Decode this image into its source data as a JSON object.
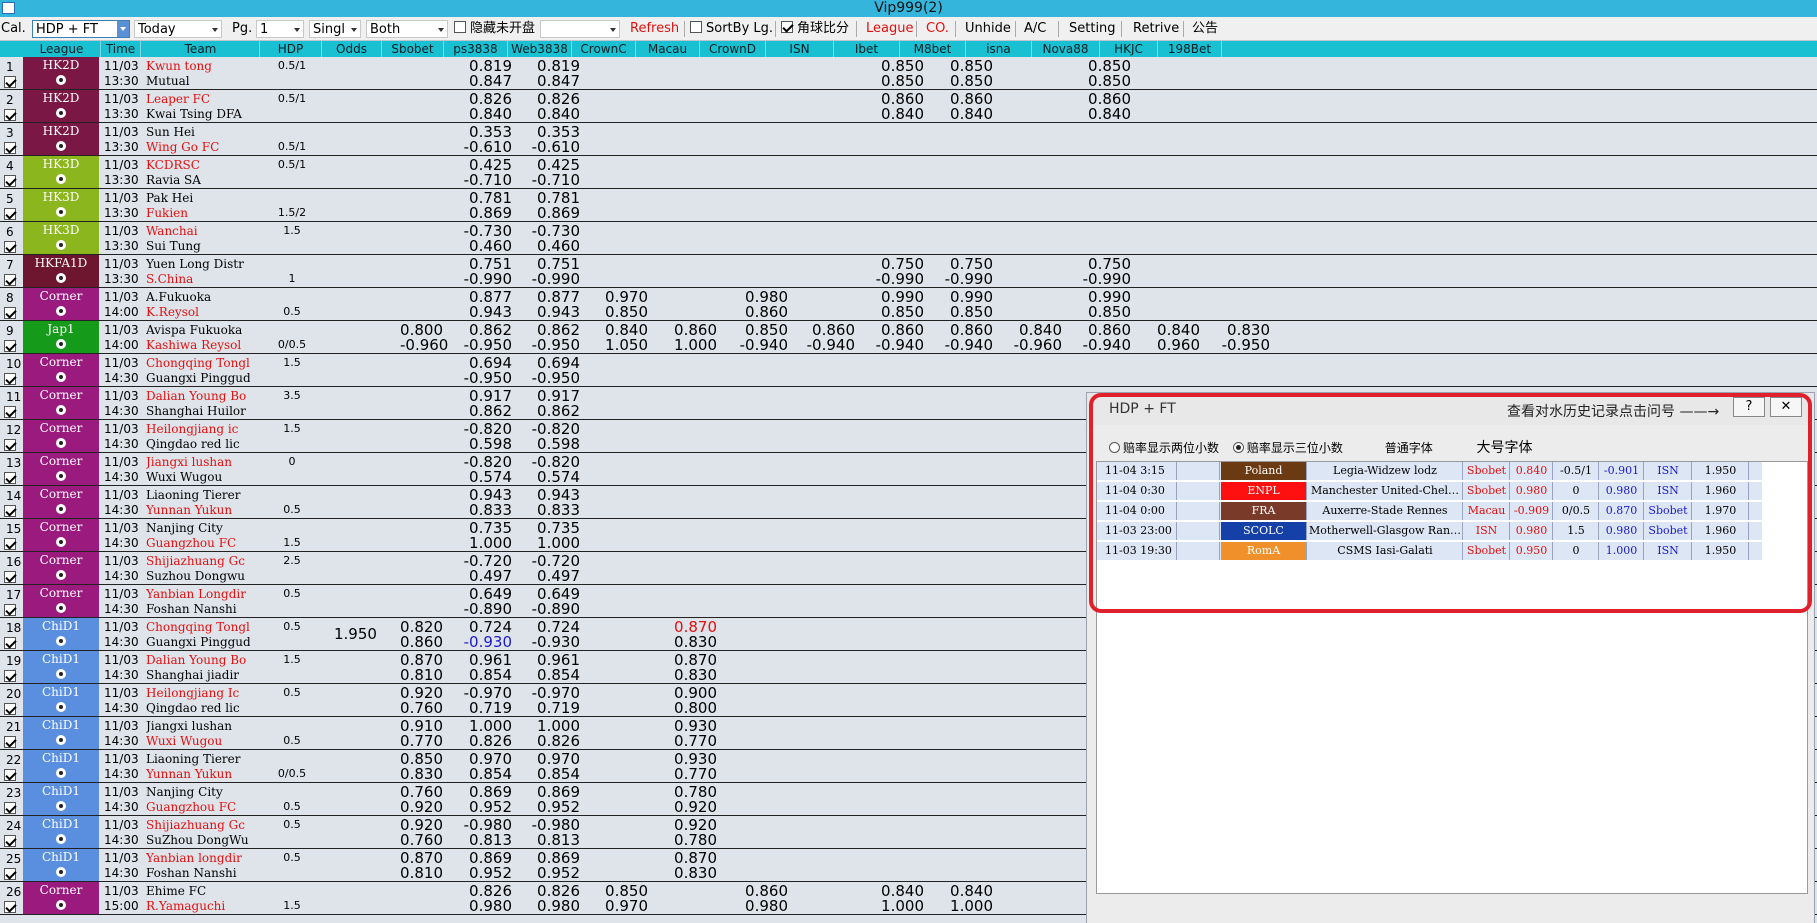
{
  "window": {
    "title": "Vip999(2)"
  },
  "toolbar": {
    "cal_label": "Cal.",
    "market_value": "HDP + FT",
    "date_value": "Today",
    "page_label": "Pg.",
    "page_value": "1",
    "single_value": "Singl",
    "both_value": "Both",
    "hide_unstarted_label": "隐藏未开盘",
    "refresh_label": "Refresh",
    "sortbylg_label": "SortBy Lg.",
    "corner_score_label": "角球比分",
    "league_label": "League",
    "co_label": "CO.",
    "unhide_label": "Unhide",
    "ac_label": "A/C",
    "setting_label": "Setting",
    "retrive_label": "Retrive",
    "notice_label": "公告"
  },
  "columns": [
    "League",
    "Time",
    "Team",
    "HDP",
    "Odds",
    "Sbobet",
    "ps3838",
    "Web3838",
    "CrownC",
    "Macau",
    "CrownD",
    "ISN",
    "Ibet",
    "M8bet",
    "isna",
    "Nova88",
    "HKJC",
    "198Bet"
  ],
  "colors": {
    "HK2D": "#7b1744",
    "HK3D": "#8cb61e",
    "HKFA1D": "#6e1530",
    "Corner": "#9a1a7e",
    "Jap1": "#169a1a",
    "ChiD1": "#5a8fe0"
  },
  "rows": [
    {
      "n": "1",
      "league": "HK2D",
      "c": "HK2D",
      "date": "11/03",
      "time": "13:30",
      "t1": "Kwun tong",
      "t2": "Mutual",
      "t1red": true,
      "t2red": false,
      "h1": "0.5/1",
      "h2": "",
      "ps": [
        "0.819",
        "0.847"
      ],
      "web": [
        "0.819",
        "0.847"
      ],
      "ibet": [
        "0.850",
        "0.850"
      ],
      "m8": [
        "0.850",
        "0.850"
      ],
      "nova": [
        "0.850",
        "0.850"
      ]
    },
    {
      "n": "2",
      "league": "HK2D",
      "c": "HK2D",
      "date": "11/03",
      "time": "13:30",
      "t1": "Leaper FC",
      "t2": "Kwai Tsing DFA",
      "t1red": true,
      "t2red": false,
      "h1": "0.5/1",
      "h2": "",
      "ps": [
        "0.826",
        "0.840"
      ],
      "web": [
        "0.826",
        "0.840"
      ],
      "ibet": [
        "0.860",
        "0.840"
      ],
      "m8": [
        "0.860",
        "0.840"
      ],
      "nova": [
        "0.860",
        "0.840"
      ]
    },
    {
      "n": "3",
      "league": "HK2D",
      "c": "HK2D",
      "date": "11/03",
      "time": "13:30",
      "t1": "Sun Hei",
      "t2": "Wing Go FC",
      "t1red": false,
      "t2red": true,
      "h1": "",
      "h2": "0.5/1",
      "ps": [
        "0.353",
        "-0.610"
      ],
      "web": [
        "0.353",
        "-0.610"
      ]
    },
    {
      "n": "4",
      "league": "HK3D",
      "c": "HK3D",
      "date": "11/03",
      "time": "13:30",
      "t1": "KCDRSC",
      "t2": "Ravia SA",
      "t1red": true,
      "t2red": false,
      "h1": "0.5/1",
      "h2": "",
      "ps": [
        "0.425",
        "-0.710"
      ],
      "web": [
        "0.425",
        "-0.710"
      ]
    },
    {
      "n": "5",
      "league": "HK3D",
      "c": "HK3D",
      "date": "11/03",
      "time": "13:30",
      "t1": "Pak Hei",
      "t2": "Fukien",
      "t1red": false,
      "t2red": true,
      "h1": "",
      "h2": "1.5/2",
      "ps": [
        "0.781",
        "0.869"
      ],
      "web": [
        "0.781",
        "0.869"
      ]
    },
    {
      "n": "6",
      "league": "HK3D",
      "c": "HK3D",
      "date": "11/03",
      "time": "13:30",
      "t1": "Wanchai",
      "t2": "Sui Tung",
      "t1red": true,
      "t2red": false,
      "h1": "1.5",
      "h2": "",
      "ps": [
        "-0.730",
        "0.460"
      ],
      "web": [
        "-0.730",
        "0.460"
      ]
    },
    {
      "n": "7",
      "league": "HKFA1D",
      "c": "HKFA1D",
      "date": "11/03",
      "time": "13:30",
      "t1": "Yuen Long Distr",
      "t2": "S.China",
      "t1red": false,
      "t2red": true,
      "h1": "",
      "h2": "1",
      "ps": [
        "0.751",
        "-0.990"
      ],
      "web": [
        "0.751",
        "-0.990"
      ],
      "ibet": [
        "0.750",
        "-0.990"
      ],
      "m8": [
        "0.750",
        "-0.990"
      ],
      "nova": [
        "0.750",
        "-0.990"
      ]
    },
    {
      "n": "8",
      "league": "Corner",
      "c": "Corner",
      "date": "11/03",
      "time": "14:00",
      "t1": "A.Fukuoka",
      "t2": "K.Reysol",
      "t1red": false,
      "t2red": true,
      "h1": "",
      "h2": "0.5",
      "ps": [
        "0.877",
        "0.943"
      ],
      "web": [
        "0.877",
        "0.943"
      ],
      "crownc": [
        "0.970",
        "0.850"
      ],
      "crownd": [
        "0.980",
        "0.860"
      ],
      "ibet": [
        "0.990",
        "0.850"
      ],
      "m8": [
        "0.990",
        "0.850"
      ],
      "nova": [
        "0.990",
        "0.850"
      ]
    },
    {
      "n": "9",
      "league": "Jap1",
      "c": "Jap1",
      "date": "11/03",
      "time": "14:00",
      "t1": "Avispa Fukuoka",
      "t2": "Kashiwa Reysol",
      "t1red": false,
      "t2red": true,
      "h1": "",
      "h2": "0/0.5",
      "sbo": [
        "0.800",
        "-0.960"
      ],
      "ps": [
        "0.862",
        "-0.950"
      ],
      "web": [
        "0.862",
        "-0.950"
      ],
      "crownc": [
        "0.840",
        "1.050"
      ],
      "macau": [
        "0.860",
        "1.000"
      ],
      "crownd": [
        "0.850",
        "-0.940"
      ],
      "isn": [
        "0.860",
        "-0.940"
      ],
      "ibet": [
        "0.860",
        "-0.940"
      ],
      "m8": [
        "0.860",
        "-0.940"
      ],
      "isna": [
        "0.840",
        "-0.960"
      ],
      "nova": [
        "0.860",
        "-0.940"
      ],
      "hkjc": [
        "0.840",
        "0.960"
      ],
      "b198": [
        "0.830",
        "-0.950"
      ]
    },
    {
      "n": "10",
      "league": "Corner",
      "c": "Corner",
      "date": "11/03",
      "time": "14:30",
      "t1": "Chongqing Tongl",
      "t2": "Guangxi Pinggud",
      "t1red": true,
      "t2red": false,
      "h1": "1.5",
      "h2": "",
      "ps": [
        "0.694",
        "-0.950"
      ],
      "web": [
        "0.694",
        "-0.950"
      ]
    },
    {
      "n": "11",
      "league": "Corner",
      "c": "Corner",
      "date": "11/03",
      "time": "14:30",
      "t1": "Dalian Young Bo",
      "t2": "Shanghai Huilor",
      "t1red": true,
      "t2red": false,
      "h1": "3.5",
      "h2": "",
      "ps": [
        "0.917",
        "0.862"
      ],
      "web": [
        "0.917",
        "0.862"
      ]
    },
    {
      "n": "12",
      "league": "Corner",
      "c": "Corner",
      "date": "11/03",
      "time": "14:30",
      "t1": "Heilongjiang ic",
      "t2": "Qingdao red lic",
      "t1red": true,
      "t2red": false,
      "h1": "1.5",
      "h2": "",
      "ps": [
        "-0.820",
        "0.598"
      ],
      "web": [
        "-0.820",
        "0.598"
      ]
    },
    {
      "n": "13",
      "league": "Corner",
      "c": "Corner",
      "date": "11/03",
      "time": "14:30",
      "t1": "Jiangxi lushan",
      "t2": "Wuxi Wugou",
      "t1red": true,
      "t2red": false,
      "h1": "0",
      "h2": "",
      "ps": [
        "-0.820",
        "0.574"
      ],
      "web": [
        "-0.820",
        "0.574"
      ]
    },
    {
      "n": "14",
      "league": "Corner",
      "c": "Corner",
      "date": "11/03",
      "time": "14:30",
      "t1": "Liaoning Tierer",
      "t2": "Yunnan Yukun",
      "t1red": false,
      "t2red": true,
      "h1": "",
      "h2": "0.5",
      "ps": [
        "0.943",
        "0.833"
      ],
      "web": [
        "0.943",
        "0.833"
      ]
    },
    {
      "n": "15",
      "league": "Corner",
      "c": "Corner",
      "date": "11/03",
      "time": "14:30",
      "t1": "Nanjing City",
      "t2": "Guangzhou FC",
      "t1red": false,
      "t2red": true,
      "h1": "",
      "h2": "1.5",
      "ps": [
        "0.735",
        "1.000"
      ],
      "web": [
        "0.735",
        "1.000"
      ]
    },
    {
      "n": "16",
      "league": "Corner",
      "c": "Corner",
      "date": "11/03",
      "time": "14:30",
      "t1": "Shijiazhuang Gc",
      "t2": "Suzhou Dongwu",
      "t1red": true,
      "t2red": false,
      "h1": "2.5",
      "h2": "",
      "ps": [
        "-0.720",
        "0.497"
      ],
      "web": [
        "-0.720",
        "0.497"
      ]
    },
    {
      "n": "17",
      "league": "Corner",
      "c": "Corner",
      "date": "11/03",
      "time": "14:30",
      "t1": "Yanbian Longdir",
      "t2": "Foshan Nanshi",
      "t1red": true,
      "t2red": false,
      "h1": "0.5",
      "h2": "",
      "ps": [
        "0.649",
        "-0.890"
      ],
      "web": [
        "0.649",
        "-0.890"
      ]
    },
    {
      "n": "18",
      "league": "ChiD1",
      "c": "ChiD1",
      "date": "11/03",
      "time": "14:30",
      "t1": "Chongqing Tongl",
      "t2": "Guangxi Pinggud",
      "t1red": true,
      "t2red": false,
      "h1": "0.5",
      "h2": "",
      "odds": "1.950",
      "sbo": [
        "0.820",
        "0.860"
      ],
      "ps": [
        "0.724",
        "-0.930"
      ],
      "psblue2": true,
      "web": [
        "0.724",
        "-0.930"
      ],
      "macau": [
        "0.870",
        "0.830"
      ],
      "macaured1": true
    },
    {
      "n": "19",
      "league": "ChiD1",
      "c": "ChiD1",
      "date": "11/03",
      "time": "14:30",
      "t1": "Dalian Young Bo",
      "t2": "Shanghai jiadir",
      "t1red": true,
      "t2red": false,
      "h1": "1.5",
      "h2": "",
      "sbo": [
        "0.870",
        "0.810"
      ],
      "ps": [
        "0.961",
        "0.854"
      ],
      "web": [
        "0.961",
        "0.854"
      ],
      "macau": [
        "0.870",
        "0.830"
      ]
    },
    {
      "n": "20",
      "league": "ChiD1",
      "c": "ChiD1",
      "date": "11/03",
      "time": "14:30",
      "t1": "Heilongjiang Ic",
      "t2": "Qingdao red lic",
      "t1red": true,
      "t2red": false,
      "h1": "0.5",
      "h2": "",
      "sbo": [
        "0.920",
        "0.760"
      ],
      "ps": [
        "-0.970",
        "0.719"
      ],
      "web": [
        "-0.970",
        "0.719"
      ],
      "macau": [
        "0.900",
        "0.800"
      ]
    },
    {
      "n": "21",
      "league": "ChiD1",
      "c": "ChiD1",
      "date": "11/03",
      "time": "14:30",
      "t1": "Jiangxi lushan",
      "t2": "Wuxi Wugou",
      "t1red": false,
      "t2red": true,
      "h1": "",
      "h2": "0.5",
      "sbo": [
        "0.910",
        "0.770"
      ],
      "ps": [
        "1.000",
        "0.826"
      ],
      "web": [
        "1.000",
        "0.826"
      ],
      "macau": [
        "0.930",
        "0.770"
      ]
    },
    {
      "n": "22",
      "league": "ChiD1",
      "c": "ChiD1",
      "date": "11/03",
      "time": "14:30",
      "t1": "Liaoning Tierer",
      "t2": "Yunnan Yukun",
      "t1red": false,
      "t2red": true,
      "h1": "",
      "h2": "0/0.5",
      "sbo": [
        "0.850",
        "0.830"
      ],
      "ps": [
        "0.970",
        "0.854"
      ],
      "web": [
        "0.970",
        "0.854"
      ],
      "macau": [
        "0.930",
        "0.770"
      ]
    },
    {
      "n": "23",
      "league": "ChiD1",
      "c": "ChiD1",
      "date": "11/03",
      "time": "14:30",
      "t1": "Nanjing City",
      "t2": "Guangzhou FC",
      "t1red": false,
      "t2red": true,
      "h1": "",
      "h2": "0.5",
      "sbo": [
        "0.760",
        "0.920"
      ],
      "ps": [
        "0.869",
        "0.952"
      ],
      "web": [
        "0.869",
        "0.952"
      ],
      "macau": [
        "0.780",
        "0.920"
      ]
    },
    {
      "n": "24",
      "league": "ChiD1",
      "c": "ChiD1",
      "date": "11/03",
      "time": "14:30",
      "t1": "Shijiazhuang Gc",
      "t2": "SuZhou DongWu",
      "t1red": true,
      "t2red": false,
      "h1": "0.5",
      "h2": "",
      "sbo": [
        "0.920",
        "0.760"
      ],
      "ps": [
        "-0.980",
        "0.813"
      ],
      "web": [
        "-0.980",
        "0.813"
      ],
      "macau": [
        "0.920",
        "0.780"
      ]
    },
    {
      "n": "25",
      "league": "ChiD1",
      "c": "ChiD1",
      "date": "11/03",
      "time": "14:30",
      "t1": "Yanbian longdir",
      "t2": "Foshan Nanshi",
      "t1red": true,
      "t2red": false,
      "h1": "0.5",
      "h2": "",
      "sbo": [
        "0.870",
        "0.810"
      ],
      "ps": [
        "0.869",
        "0.952"
      ],
      "web": [
        "0.869",
        "0.952"
      ],
      "macau": [
        "0.870",
        "0.830"
      ]
    },
    {
      "n": "26",
      "league": "Corner",
      "c": "Corner",
      "date": "11/03",
      "time": "15:00",
      "t1": "Ehime FC",
      "t2": "R.Yamaguchi",
      "t1red": false,
      "t2red": true,
      "h1": "",
      "h2": "1.5",
      "ps": [
        "0.826",
        "0.980"
      ],
      "web": [
        "0.826",
        "0.980"
      ],
      "crownc": [
        "0.850",
        "0.970"
      ],
      "crownd": [
        "0.860",
        "0.980"
      ],
      "ibet": [
        "0.840",
        "1.000"
      ],
      "m8": [
        "0.840",
        "1.000"
      ],
      "nova": [
        "0.840",
        "1.000"
      ]
    }
  ],
  "popup": {
    "title": "HDP + FT",
    "hint": "查看对水历史记录点击问号 ——→",
    "help_label": "?",
    "close_label": "✕",
    "radio_two": "赔率显示两位小数",
    "radio_three": "赔率显示三位小数",
    "font_normal": "普通字体",
    "font_large": "大号字体",
    "history": [
      {
        "time": "11-04 3:15",
        "league": "Poland",
        "lcolor": "#6b3a12",
        "match": "Legia-Widzew lodz",
        "b1": "Sbobet",
        "o1": "0.840",
        "hdp": "-0.5/1",
        "o2": "-0.901",
        "b2": "ISN",
        "sum": "1.950"
      },
      {
        "time": "11-04 0:30",
        "league": "ENPL",
        "lcolor": "#ff1010",
        "match": "Manchester United-Chel…",
        "b1": "Sbobet",
        "o1": "0.980",
        "hdp": "0",
        "o2": "0.980",
        "b2": "ISN",
        "sum": "1.960"
      },
      {
        "time": "11-04 0:00",
        "league": "FRA",
        "lcolor": "#7a3a2a",
        "match": "Auxerre-Stade Rennes",
        "b1": "Macau",
        "o1": "-0.909",
        "hdp": "0/0.5",
        "o2": "0.870",
        "b2": "Sbobet",
        "sum": "1.970"
      },
      {
        "time": "11-03 23:00",
        "league": "SCOLC",
        "lcolor": "#1540a8",
        "match": "Motherwell-Glasgow Ran…",
        "b1": "ISN",
        "o1": "0.980",
        "hdp": "1.5",
        "o2": "0.980",
        "b2": "Sbobet",
        "sum": "1.960"
      },
      {
        "time": "11-03 19:30",
        "league": "RomA",
        "lcolor": "#f0902a",
        "match": "CSMS Iasi-Galati",
        "b1": "Sbobet",
        "o1": "0.950",
        "hdp": "0",
        "o2": "1.000",
        "b2": "ISN",
        "sum": "1.950"
      }
    ]
  }
}
